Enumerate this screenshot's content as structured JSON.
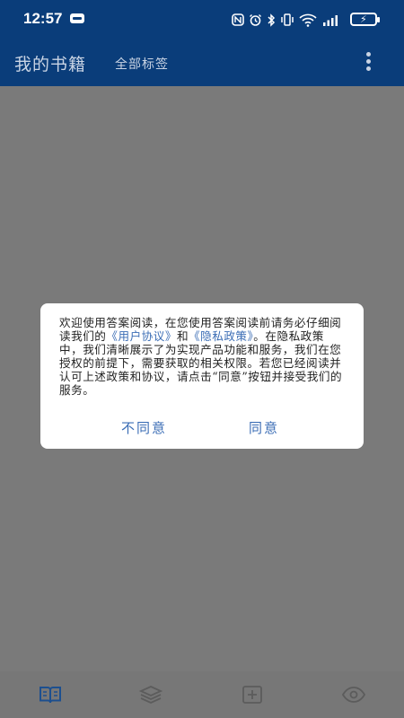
{
  "status_bar": {
    "time": "12:57",
    "icons": [
      "nfc-icon",
      "alarm-icon",
      "bluetooth-icon",
      "vibrate-icon",
      "wifi-icon",
      "signal-icon",
      "battery-charging-icon"
    ]
  },
  "app_bar": {
    "title": "我的书籍",
    "tag_filter": "全部标签",
    "more_icon": "more-vert-icon"
  },
  "dialog": {
    "text_before_link1": "欢迎使用答案阅读，在您使用答案阅读前请务必仔细阅读我们的",
    "link_user_agreement": "《用户协议》",
    "text_between": "和",
    "link_privacy_policy": "《隐私政策》",
    "text_after": "。在隐私政策中，我们清晰展示了为实现产品功能和服务，我们在您授权的前提下，需要获取的相关权限。若您已经阅读并认可上述政策和协议，请点击“同意”按钮并接受我们的服务。",
    "disagree_label": "不同意",
    "agree_label": "同意"
  },
  "tab_bar": {
    "tabs": [
      {
        "icon": "book-icon",
        "active": true
      },
      {
        "icon": "layers-icon",
        "active": false
      },
      {
        "icon": "add-box-icon",
        "active": false
      },
      {
        "icon": "eye-icon",
        "active": false
      }
    ]
  },
  "colors": {
    "primary": "#0a3d7a",
    "link": "#3b6db5",
    "overlay": "#7a7a7a"
  }
}
